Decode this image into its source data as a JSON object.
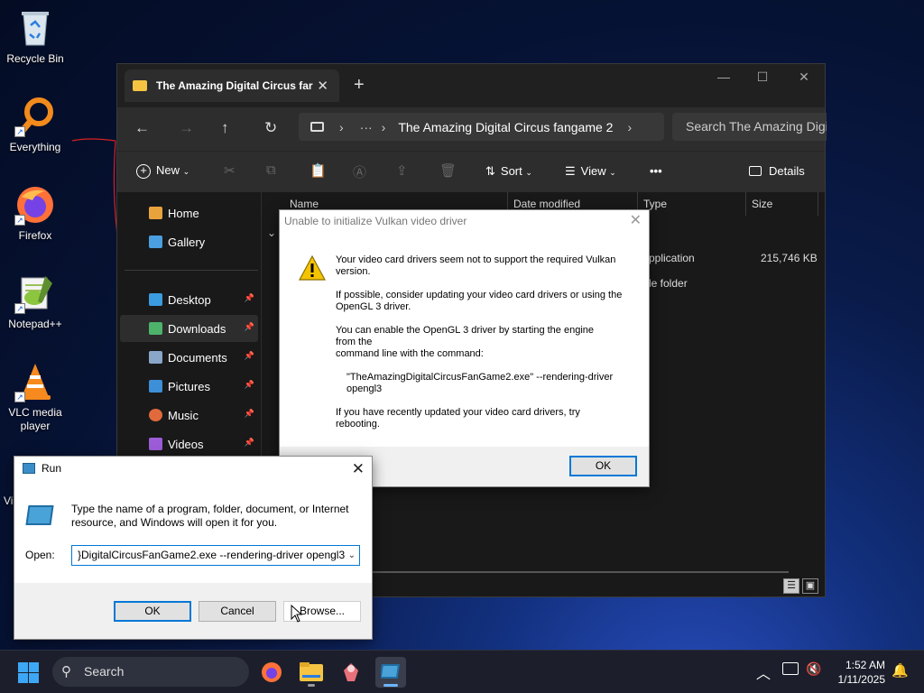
{
  "desktop": {
    "icons": [
      {
        "label": "Recycle Bin",
        "icon": "recycle-bin-icon"
      },
      {
        "label": "Everything",
        "icon": "everything-search-icon"
      },
      {
        "label": "Firefox",
        "icon": "firefox-icon"
      },
      {
        "label": "Notepad++",
        "icon": "notepad-plus-plus-icon"
      },
      {
        "label": "VLC media player",
        "icon": "vlc-icon"
      },
      {
        "label": "Vi",
        "icon": "partial-icon"
      }
    ]
  },
  "explorer": {
    "tab_title": "The Amazing Digital Circus far",
    "new_tab": "+",
    "address_path": "The Amazing Digital Circus fangame 2",
    "search_placeholder": "Search The Amazing Digi",
    "toolbar": {
      "new": "New",
      "sort": "Sort",
      "view": "View",
      "more": "•••",
      "details": "Details"
    },
    "sidebar": [
      {
        "label": "Home",
        "color": "#e8a33c",
        "pinned": false
      },
      {
        "label": "Gallery",
        "color": "#4a9fe0",
        "pinned": false
      },
      {
        "label": "Desktop",
        "color": "#3c9ce0",
        "pinned": true
      },
      {
        "label": "Downloads",
        "color": "#4db36b",
        "pinned": true,
        "active": true
      },
      {
        "label": "Documents",
        "color": "#8aa6c8",
        "pinned": true
      },
      {
        "label": "Pictures",
        "color": "#3d8fd8",
        "pinned": true
      },
      {
        "label": "Music",
        "color": "#e06a3c",
        "pinned": true
      },
      {
        "label": "Videos",
        "color": "#9d5cd8",
        "pinned": true
      }
    ],
    "columns": {
      "name": "Name",
      "date": "Date modified",
      "type": "Type",
      "size": "Size"
    },
    "rows": [
      {
        "type": "pplication",
        "size": "215,746 KB"
      },
      {
        "type": "le folder",
        "size": ""
      }
    ]
  },
  "vulkan_dialog": {
    "title": "Unable to initialize Vulkan video driver",
    "close": "✕",
    "p1": "Your video card drivers seem not to support the required Vulkan version.",
    "p2": "If possible, consider updating your video card drivers or using the OpenGL 3 driver.",
    "p3a": "You can enable the OpenGL 3 driver by starting the engine from the",
    "p3b": "command line with the command:",
    "p4": "\"TheAmazingDigitalCircusFanGame2.exe\" --rendering-driver opengl3",
    "p5": "If you have recently updated your video card drivers, try rebooting.",
    "ok": "OK"
  },
  "run_dialog": {
    "title": "Run",
    "close": "✕",
    "description": "Type the name of a program, folder, document, or Internet resource, and Windows will open it for you.",
    "open_label": "Open:",
    "open_value": "}DigitalCircusFanGame2.exe --rendering-driver opengl3",
    "ok": "OK",
    "cancel": "Cancel",
    "browse": "Browse..."
  },
  "taskbar": {
    "search": "Search",
    "time": "1:52 AM",
    "date": "1/11/2025"
  }
}
